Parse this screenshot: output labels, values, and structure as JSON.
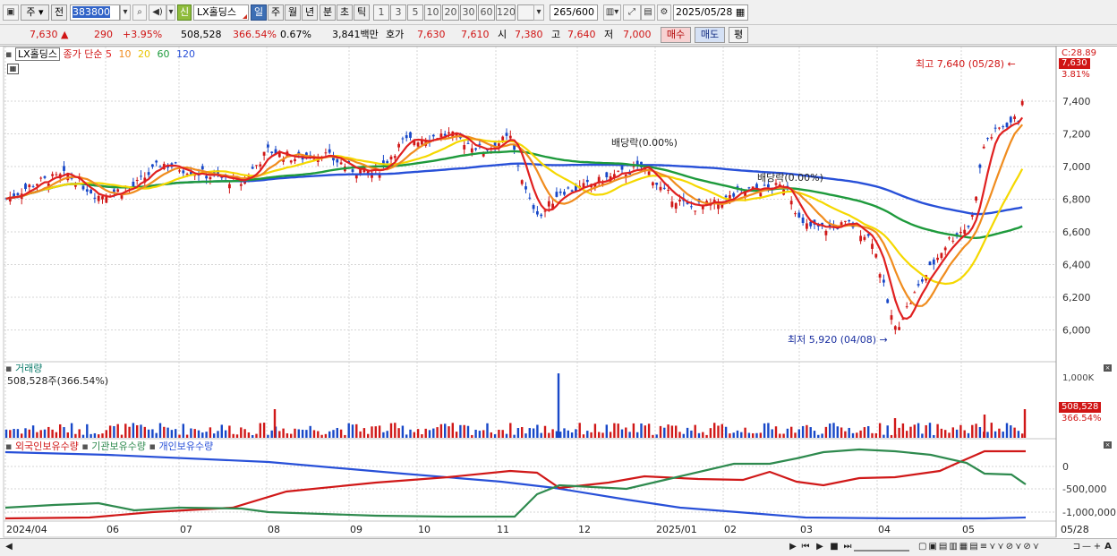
{
  "toolbar": {
    "period_primary": "주",
    "period_secondary": "전",
    "stock_code": "383800",
    "sin_label": "신",
    "stock_name": "LX홀딩스",
    "periods": [
      "일",
      "주",
      "월",
      "년",
      "분",
      "초",
      "틱"
    ],
    "active_period": "일",
    "intervals": [
      "1",
      "3",
      "5",
      "10",
      "20",
      "30",
      "60",
      "120"
    ],
    "count": "265",
    "count_total": "/600",
    "date": "2025/05/28"
  },
  "quote": {
    "price": "7,630",
    "change_arrow": "▲",
    "change": "290",
    "change_pct": "+3.95%",
    "volume": "508,528",
    "volume_ratio": "366.54%",
    "turnover": "0.67%",
    "amount": "3,841백만",
    "bid_label": "호가",
    "ask": "7,630",
    "bid": "7,610",
    "open_label": "시",
    "open": "7,380",
    "high_label": "고",
    "high": "7,640",
    "low_label": "저",
    "low": "7,000",
    "buy_label": "매수",
    "sell_label": "매도",
    "avg_label": "평"
  },
  "price_panel": {
    "name_box": "LX홀딩스",
    "ma_label": "종가 단순",
    "ma_periods": [
      {
        "label": "5",
        "color": "#e02020"
      },
      {
        "label": "10",
        "color": "#f08c1e"
      },
      {
        "label": "20",
        "color": "#f5d800"
      },
      {
        "label": "60",
        "color": "#1e9a3c"
      },
      {
        "label": "120",
        "color": "#2850d8"
      }
    ],
    "max_note": "최고 7,640 (05/28)",
    "min_note": "최저 5,920 (04/08)",
    "dividend_1": "배당락(0.00%)",
    "dividend_2": "배당락(0.00%)",
    "corner_label": "C:28.89",
    "current_price_tag": "7,630",
    "current_pct_tag": "3.81%",
    "y_ticks": [
      "7,400",
      "7,200",
      "7,000",
      "6,800",
      "6,600",
      "6,400",
      "6,200",
      "6,000"
    ]
  },
  "volume_panel": {
    "title": "거래량",
    "subtitle": "508,528주(366.54%)",
    "y_tick": "1,000K",
    "tag_value": "508,528",
    "tag_pct": "366.54%"
  },
  "holdings_panel": {
    "series_labels": [
      "외국인보유수량",
      "기관보유수량",
      "개인보유수량"
    ],
    "series_colors": [
      "#d01818",
      "#2e8a4e",
      "#2850d8"
    ],
    "y_ticks": [
      "0",
      "-500,000",
      "-1,000,000"
    ]
  },
  "x_axis": {
    "labels": [
      "2024/04",
      "06",
      "07",
      "08",
      "09",
      "10",
      "11",
      "12",
      "2025/01",
      "02",
      "03",
      "04",
      "05"
    ],
    "last_label": "05/28"
  }
}
